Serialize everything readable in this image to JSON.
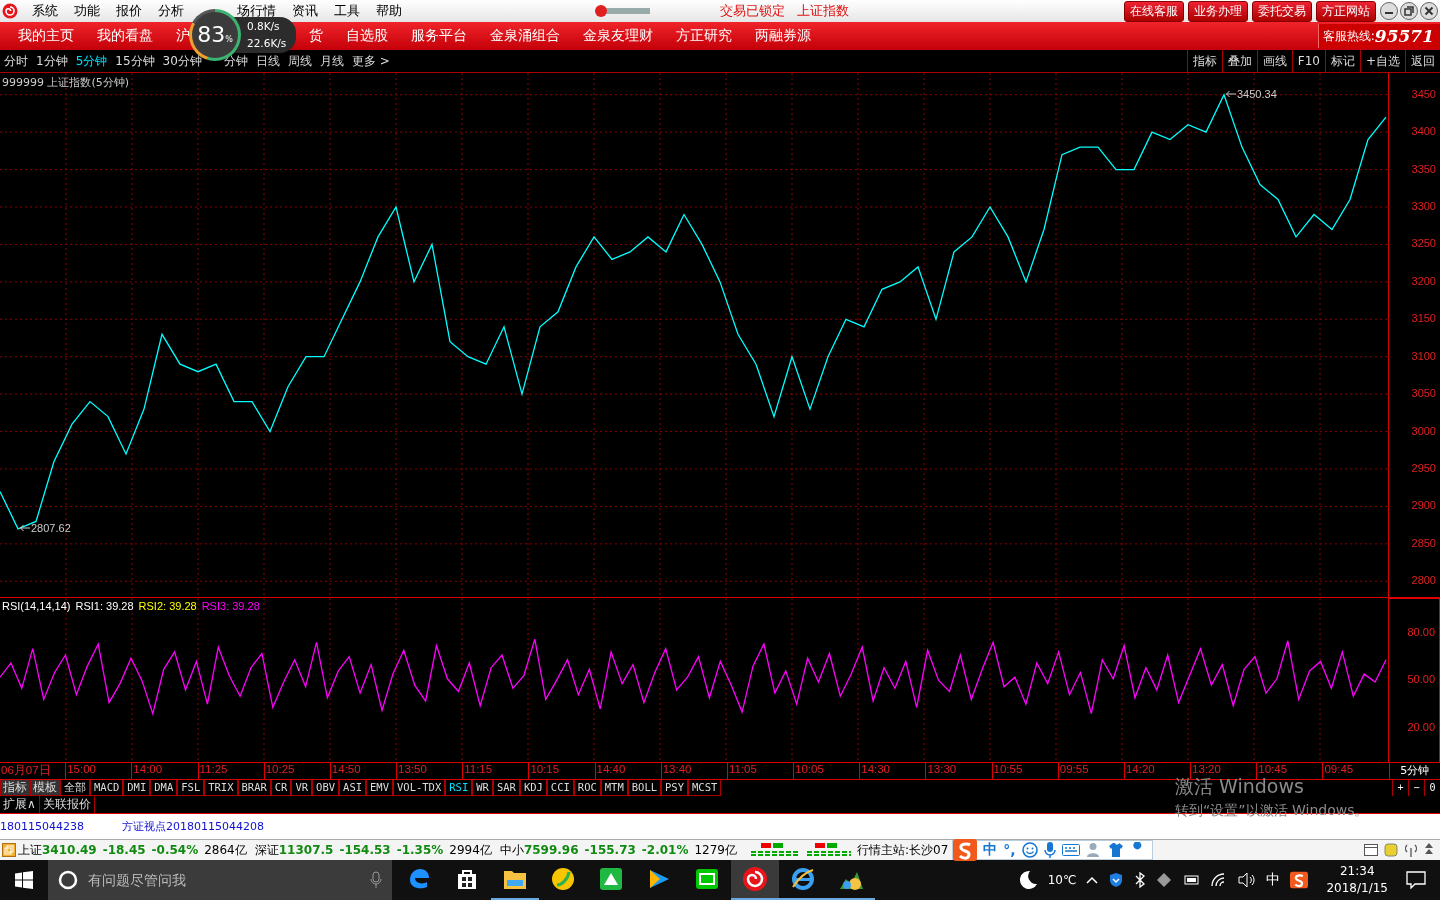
{
  "menu_bar": {
    "items": [
      "系统",
      "功能",
      "报价",
      "分析",
      "场行情",
      "资讯",
      "工具",
      "帮助"
    ],
    "slider": {
      "level": 0.1
    },
    "status_texts": [
      "交易已锁定",
      "上证指数"
    ],
    "buttons": [
      "在线客服",
      "业务办理",
      "委托交易",
      "方正网站"
    ]
  },
  "speed_widget": {
    "percent": "83",
    "unit": "%",
    "upload": "0.8K/s",
    "download": "22.6K/s"
  },
  "nav": {
    "items": [
      "我的主页",
      "我的看盘",
      "沪",
      "货",
      "自选股",
      "服务平台",
      "金泉涌组合",
      "金泉友理财",
      "方正研究",
      "两融券源"
    ],
    "hotline_label": "客服热线:",
    "hotline": "95571"
  },
  "periods": [
    {
      "label": "分时",
      "selected": false
    },
    {
      "label": "1分钟",
      "selected": false
    },
    {
      "label": "5分钟",
      "selected": true
    },
    {
      "label": "15分钟",
      "selected": false
    },
    {
      "label": "30分钟",
      "selected": false
    },
    {
      "label": "分钟",
      "selected": false
    },
    {
      "label": "日线",
      "selected": false
    },
    {
      "label": "周线",
      "selected": false
    },
    {
      "label": "月线",
      "selected": false
    },
    {
      "label": "更多 >",
      "selected": false
    }
  ],
  "tools": [
    "指标",
    "叠加",
    "画线",
    "F10",
    "标记",
    "+自选",
    "返回"
  ],
  "price_chart": {
    "title": "999999 上证指数(5分钟)",
    "chart_data": {
      "type": "line",
      "grid": true,
      "ylim": [
        2779,
        3479
      ],
      "yticks": [
        2800,
        2850,
        2900,
        2950,
        3000,
        3050,
        3100,
        3150,
        3200,
        3250,
        3300,
        3350,
        3400,
        3450
      ],
      "series": [
        {
          "color": "#00ffff",
          "values": [
            2920,
            2870,
            2880,
            2960,
            3010,
            3040,
            3020,
            2970,
            3030,
            3130,
            3090,
            3080,
            3090,
            3040,
            3040,
            3000,
            3060,
            3100,
            3100,
            3150,
            3200,
            3260,
            3300,
            3200,
            3250,
            3120,
            3100,
            3090,
            3140,
            3050,
            3140,
            3160,
            3220,
            3260,
            3230,
            3240,
            3260,
            3240,
            3290,
            3250,
            3200,
            3130,
            3090,
            3020,
            3100,
            3030,
            3100,
            3150,
            3140,
            3190,
            3200,
            3220,
            3150,
            3240,
            3260,
            3300,
            3260,
            3200,
            3270,
            3370,
            3380,
            3380,
            3350,
            3350,
            3400,
            3390,
            3410,
            3400,
            3450,
            3380,
            3330,
            3310,
            3260,
            3290,
            3270,
            3310,
            3390,
            3420
          ]
        }
      ],
      "annotations": [
        "3450.34",
        "2807.62"
      ]
    }
  },
  "rsi_panel": {
    "legend": [
      {
        "text": "RSI(14,14,14)",
        "color": "#ffffff"
      },
      {
        "text": "RSI1: 39.28",
        "color": "#ffffff"
      },
      {
        "text": "RSI2: 39.28",
        "color": "#ffff00"
      },
      {
        "text": "RSI3: 39.28",
        "color": "#ff00ff"
      }
    ],
    "chart_data": {
      "type": "line",
      "grid": true,
      "ylim": [
        -1.5,
        102
      ],
      "yticks": [
        {
          "value": 80,
          "label": "80.00"
        },
        {
          "value": 50,
          "label": "50.00"
        },
        {
          "value": 20,
          "label": "20.00"
        }
      ],
      "series": [
        {
          "color": "#ff00ff",
          "values": [
            52,
            61,
            45,
            70,
            38,
            55,
            66,
            41,
            59,
            73,
            36,
            48,
            64,
            50,
            29,
            57,
            68,
            44,
            62,
            35,
            71,
            53,
            40,
            58,
            67,
            33,
            49,
            63,
            46,
            74,
            39,
            56,
            65,
            42,
            60,
            31,
            54,
            69,
            47,
            37,
            72,
            51,
            43,
            61,
            34,
            58,
            66,
            45,
            53,
            76,
            38,
            50,
            63,
            41,
            57,
            32,
            68,
            48,
            60,
            36,
            55,
            70,
            44,
            52,
            65,
            39,
            62,
            47,
            30,
            59,
            73,
            42,
            56,
            35,
            64,
            49,
            67,
            40,
            54,
            71,
            37,
            58,
            45,
            62,
            33,
            69,
            50,
            43,
            66,
            38,
            57,
            74,
            46,
            52,
            35,
            61,
            48,
            68,
            41,
            55,
            29,
            63,
            51,
            72,
            39,
            58,
            44,
            66,
            36,
            53,
            70,
            47,
            60,
            34,
            57,
            65,
            42,
            51,
            75,
            38,
            56,
            62,
            45,
            68,
            40,
            54,
            49,
            63
          ]
        }
      ]
    }
  },
  "time_axis": {
    "labels": [
      "06月07日",
      "15:00",
      "14:00",
      "11:25",
      "10:25",
      "14:50",
      "13:50",
      "11:15",
      "10:15",
      "14:40",
      "13:40",
      "11:05",
      "10:05",
      "14:30",
      "13:30",
      "10:55",
      "09:55",
      "14:20",
      "13:20",
      "10:45",
      "09:45"
    ],
    "period": "5分钟"
  },
  "indicator_tabs": [
    {
      "label": "指标",
      "kind": "tool"
    },
    {
      "label": "模板",
      "kind": "tool"
    },
    {
      "label": "全部",
      "kind": "indicator",
      "selected": false
    },
    {
      "label": "MACD",
      "kind": "indicator",
      "selected": false
    },
    {
      "label": "DMI",
      "kind": "indicator",
      "selected": false
    },
    {
      "label": "DMA",
      "kind": "indicator",
      "selected": false
    },
    {
      "label": "FSL",
      "kind": "indicator",
      "selected": false
    },
    {
      "label": "TRIX",
      "kind": "indicator",
      "selected": false
    },
    {
      "label": "BRAR",
      "kind": "indicator",
      "selected": false
    },
    {
      "label": "CR",
      "kind": "indicator",
      "selected": false
    },
    {
      "label": "VR",
      "kind": "indicator",
      "selected": false
    },
    {
      "label": "OBV",
      "kind": "indicator",
      "selected": false
    },
    {
      "label": "ASI",
      "kind": "indicator",
      "selected": false
    },
    {
      "label": "EMV",
      "kind": "indicator",
      "selected": false
    },
    {
      "label": "VOL-TDX",
      "kind": "indicator",
      "selected": false
    },
    {
      "label": "RSI",
      "kind": "indicator",
      "selected": true
    },
    {
      "label": "WR",
      "kind": "indicator",
      "selected": false
    },
    {
      "label": "SAR",
      "kind": "indicator",
      "selected": false
    },
    {
      "label": "KDJ",
      "kind": "indicator",
      "selected": false
    },
    {
      "label": "CCI",
      "kind": "indicator",
      "selected": false
    },
    {
      "label": "ROC",
      "kind": "indicator",
      "selected": false
    },
    {
      "label": "MTM",
      "kind": "indicator",
      "selected": false
    },
    {
      "label": "BOLL",
      "kind": "indicator",
      "selected": false
    },
    {
      "label": "PSY",
      "kind": "indicator",
      "selected": false
    },
    {
      "label": "MCST",
      "kind": "indicator",
      "selected": false
    }
  ],
  "zoom_buttons": [
    "+",
    "−",
    "0"
  ],
  "extra_tabs": [
    "扩展∧",
    "关联报价"
  ],
  "activation_notice": [
    "激活 Windows",
    "转到“设置”以激活 Windows。"
  ],
  "news_ticker": [
    "180115044238",
    "方证视点20180115044208"
  ],
  "status_bar": {
    "quotes": [
      {
        "name": "上证",
        "value": "3410.49",
        "change": "-18.45",
        "pct": "-0.54%",
        "volume": "2864亿",
        "down": true
      },
      {
        "name": "深证",
        "value": "11307.5",
        "change": "-154.53",
        "pct": "-1.35%",
        "volume": "2994亿",
        "down": true
      },
      {
        "name": "中小",
        "value": "7599.96",
        "change": "-155.73",
        "pct": "-2.01%",
        "volume": "1279亿",
        "down": true
      }
    ],
    "server": "行情主站:长沙07",
    "ime": {
      "mode": "中",
      "punct": "°,"
    }
  },
  "taskbar": {
    "search_placeholder": "有问题尽管问我",
    "apps": [
      {
        "kind": "edge",
        "running": false,
        "selected": false
      },
      {
        "kind": "store",
        "running": false,
        "selected": false
      },
      {
        "kind": "folder",
        "running": true,
        "selected": false
      },
      {
        "kind": "music",
        "running": false,
        "selected": false
      },
      {
        "kind": "green",
        "running": false,
        "selected": false
      },
      {
        "kind": "video",
        "running": false,
        "selected": false
      },
      {
        "kind": "tv",
        "running": false,
        "selected": false
      },
      {
        "kind": "spiral",
        "running": true,
        "selected": true
      },
      {
        "kind": "ie",
        "running": true,
        "selected": false
      },
      {
        "kind": "trader",
        "running": true,
        "selected": false
      }
    ],
    "weather": "10℃",
    "ime": "中",
    "time": "21:34",
    "date": "2018/1/15"
  }
}
